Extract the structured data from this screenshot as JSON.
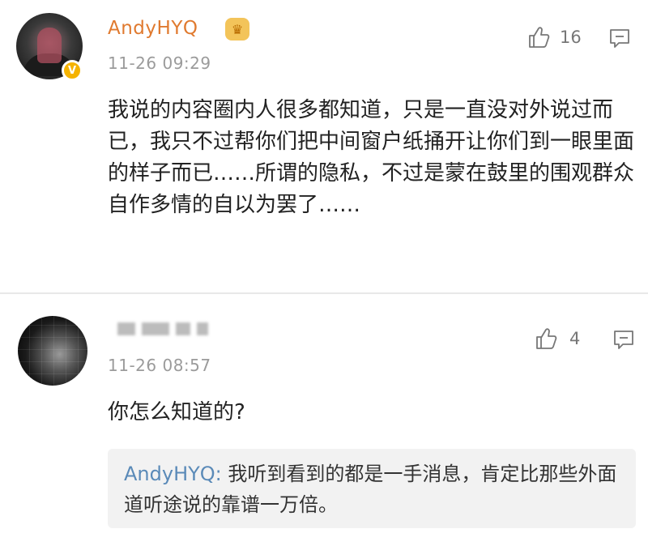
{
  "comments": [
    {
      "username": "AndyHYQ",
      "timestamp": "11-26 09:29",
      "likes": "16",
      "text": "我说的内容圈内人很多都知道，只是一直没对外说过而已，我只不过帮你们把中间窗户纸捅开让你们到一眼里面的样子而已……所谓的隐私，不过是蒙在鼓里的围观群众自作多情的自以为罢了……",
      "icons": {
        "avatar": "avatar",
        "verified": "verified-badge-icon",
        "vip": "vip-crown-icon",
        "like": "thumbs-up-icon",
        "reply": "reply-comment-icon"
      }
    },
    {
      "username_blurred": true,
      "timestamp": "11-26 08:57",
      "likes": "4",
      "text": "你怎么知道的?",
      "reply": {
        "username": "AndyHYQ:",
        "text": "我听到看到的都是一手消息，肯定比那些外面道听途说的靠谱一万倍。"
      },
      "icons": {
        "avatar": "pixelated-avatar",
        "like": "thumbs-up-icon",
        "reply": "reply-comment-icon"
      }
    }
  ],
  "colors": {
    "username": "#e07a2f",
    "reply_user": "#5a8ab8",
    "timestamp": "#9b9b9b",
    "text": "#222222",
    "reply_bg": "#f2f2f2"
  }
}
